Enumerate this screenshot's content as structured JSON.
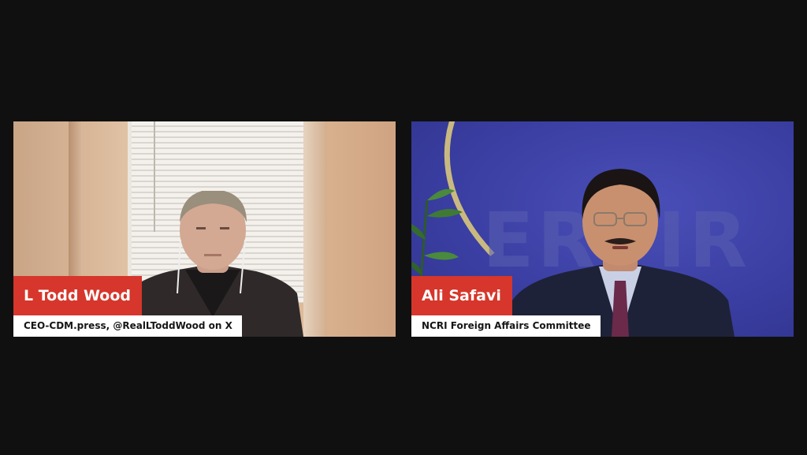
{
  "participants": [
    {
      "name": "L Todd Wood",
      "title": "CEO-CDM.press, @RealLToddWood on X"
    },
    {
      "name": "Ali Safavi",
      "title": "NCRI Foreign Affairs Committee"
    }
  ],
  "colors": {
    "background": "#101010",
    "name_tag": "#d6362b",
    "title_tag": "#ffffff",
    "backdrop_blue": "#3b3fa3",
    "backdrop_arc_gold": "#c9b980"
  }
}
